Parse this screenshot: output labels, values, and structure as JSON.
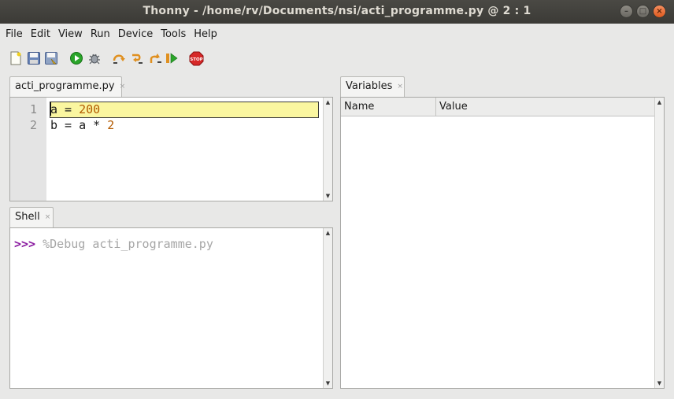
{
  "window": {
    "title": "Thonny  -  /home/rv/Documents/nsi/acti_programme.py  @  2 : 1",
    "buttons": {
      "minimize": "–",
      "maximize": "□",
      "close": "×"
    }
  },
  "menu": [
    "File",
    "Edit",
    "View",
    "Run",
    "Device",
    "Tools",
    "Help"
  ],
  "toolbar": [
    {
      "name": "new-file-icon"
    },
    {
      "name": "save-icon"
    },
    {
      "name": "save-as-icon"
    },
    {
      "name": "run-icon"
    },
    {
      "name": "debug-icon"
    },
    {
      "name": "step-over-icon"
    },
    {
      "name": "step-into-icon"
    },
    {
      "name": "step-out-icon"
    },
    {
      "name": "resume-icon"
    },
    {
      "name": "stop-icon",
      "label": "STOP"
    }
  ],
  "editor": {
    "tab_label": "acti_programme.py",
    "tab_close": "×",
    "line_numbers": [
      "1",
      "2"
    ],
    "lines": [
      {
        "prefix": "a = ",
        "number": "200"
      },
      {
        "prefix": "b = a * ",
        "number": "2"
      }
    ]
  },
  "shell": {
    "tab_label": "Shell",
    "tab_close": "×",
    "prompt": ">>>",
    "command": " %Debug acti_programme.py"
  },
  "variables": {
    "tab_label": "Variables",
    "tab_close": "×",
    "columns": [
      "Name",
      "Value"
    ]
  },
  "colors": {
    "highlight": "#faf6a0",
    "number": "#b35a00",
    "prompt": "#8a1aa0",
    "run": "#2aa52a",
    "stop": "#d62828"
  }
}
